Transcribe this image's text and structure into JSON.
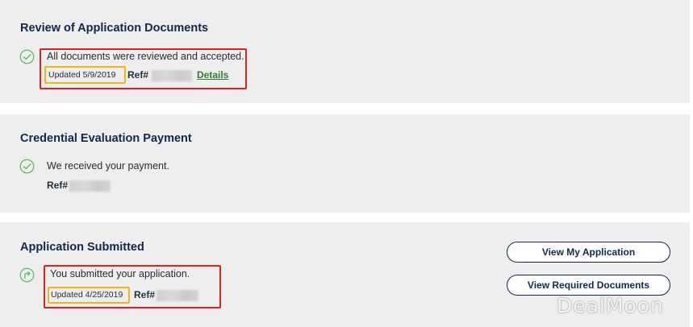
{
  "review": {
    "title": "Review of Application Documents",
    "message": "All documents were reviewed and accepted.",
    "updated": "Updated 5/9/2019",
    "ref_label": "Ref#",
    "details_link": "Details",
    "status_icon": "check-circle-icon"
  },
  "payment": {
    "title": "Credential Evaluation Payment",
    "message": "We received your payment.",
    "ref_label": "Ref#",
    "status_icon": "check-circle-icon"
  },
  "submitted": {
    "title": "Application Submitted",
    "message": "You submitted your application.",
    "updated": "Updated 4/25/2019",
    "ref_label": "Ref#",
    "status_icon": "forward-arrow-circle-icon",
    "view_application_button": "View My Application",
    "view_required_documents_button": "View Required Documents"
  },
  "watermark": "DealMoon",
  "colors": {
    "card_background": "#efeeee",
    "title": "#10284a",
    "success_green": "#5cb85c",
    "link_green": "#2e7d32",
    "highlight_red": "#e02020",
    "highlight_yellow": "#f2b418"
  }
}
